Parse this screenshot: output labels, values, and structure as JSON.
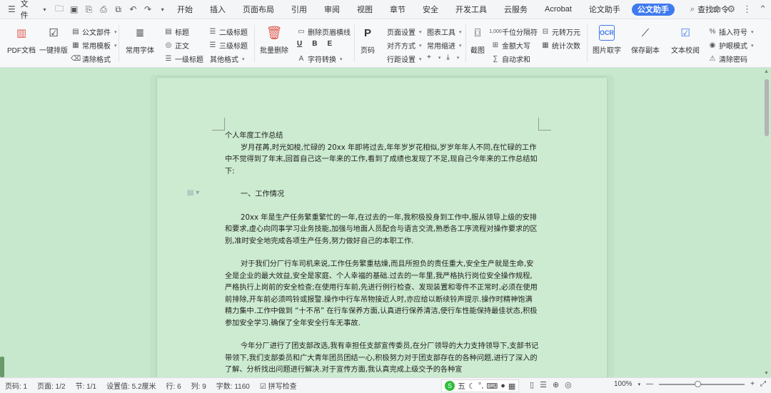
{
  "topbar": {
    "menu_label": "文件",
    "tabs": [
      "开始",
      "插入",
      "页面布局",
      "引用",
      "审阅",
      "视图",
      "章节",
      "安全",
      "开发工具",
      "云服务",
      "Acrobat",
      "论文助手"
    ],
    "active_tab": "公文助手",
    "search_label": "查找命令"
  },
  "ribbon": {
    "pdf_doc": "PDF文档",
    "one_click_layout": "一键排版",
    "doc_parts": "公文部件",
    "common_template": "常用模板",
    "clear_format": "清除格式",
    "common_font": "常用字体",
    "title": "标题",
    "body_text": "正文",
    "level1_title": "一级标题",
    "level2_title": "二级标题",
    "level3_title": "三级标题",
    "other_format": "其他格式",
    "batch_delete": "批量删除",
    "delete_header_line": "删除页眉横线",
    "char_convert": "字符转换",
    "page_number": "页码",
    "page_setup": "页面设置",
    "chart_tools": "图表工具",
    "align_mode": "对齐方式",
    "common_indent": "常用缩进",
    "line_spacing": "行距设置",
    "screenshot": "截图",
    "thousand_sep": "千位分隔符",
    "yuan_to_wan": "元转万元",
    "amount_upper": "金额大写",
    "stat_count": "统计次数",
    "auto_sum": "自动求和",
    "ocr": "图片取字",
    "save_copy": "保存副本",
    "text_proof": "文本校阅",
    "insert_symbol": "插入符号",
    "eye_mode": "护眼模式",
    "clear_password": "清除密码"
  },
  "document": {
    "title": "个人年度工作总结",
    "intro": "岁月荏苒,时光如梭,忙碌的 20xx 年即将过去,年年岁岁花相似,岁岁年年人不同,在忙碌的工作中不觉得到了年末,回首自己这一年来的工作,看到了成绩也发现了不足,现自己今年来的工作总结如下:",
    "section1": "一、工作情况",
    "para1": "20xx 年是生产任务繁重繁忙的一年,在过去的一年,我积极投身到工作中,服从领导上级的安排和要求,虚心向同事学习业务技能,加强与地面人员配合与语言交流,熟悉各工序流程对操作要求的区别,准时安全地完成各项生产任务,努力做好自己的本职工作.",
    "para2": "对于我们分厂行车司机来说,工作任务繁重枯燥,而且所担负的责任重大,安全生产就是生命,安全是企业的最大效益,安全是家庭、个人幸福的基础.过去的一年里,我严格执行岗位安全操作规程,严格执行上岗前的安全检查;在使用行车前,先进行例行检查、发现装置和零件不正常时,必须在使用前排除,开车前必须鸣铃或报警.操作中行车吊物接近人时,亦应给以断续铃声提示.操作时精神饱满精力集中.工作中做到 “十不吊” 在行车保养方面,认真进行保养清洁,使行车性能保持最佳状态,积极参加安全学习.确保了全年安全行车无事故.",
    "para3": "今年分厂进行了团支部改选,我有幸担任支部宣传委员,在分厂领导的大力支持领导下,支部书记带领下,我们支部委员和广大青年团员团结一心,积极努力对于团支部存在的各种问题,进行了深入的了解、分析找出问题进行解决.对于宣传方面,我认真完成上级交予的各种宣"
  },
  "status": {
    "page_label": "页码: 1",
    "pages": "页面: 1/2",
    "section": "节: 1/1",
    "setting": "设置值: 5.2厘米",
    "row": "行: 6",
    "col": "列: 9",
    "word_count": "字数: 1160",
    "spell_check": "拼写检查",
    "zoom": "100%",
    "zoom_level": 0.45,
    "ime_label": "五"
  },
  "colors": {
    "accent": "#3f7af0",
    "canvas_bg": "#c7e8cc",
    "page_bg": "#ccebd0",
    "ime_green": "#2ebd3c"
  }
}
